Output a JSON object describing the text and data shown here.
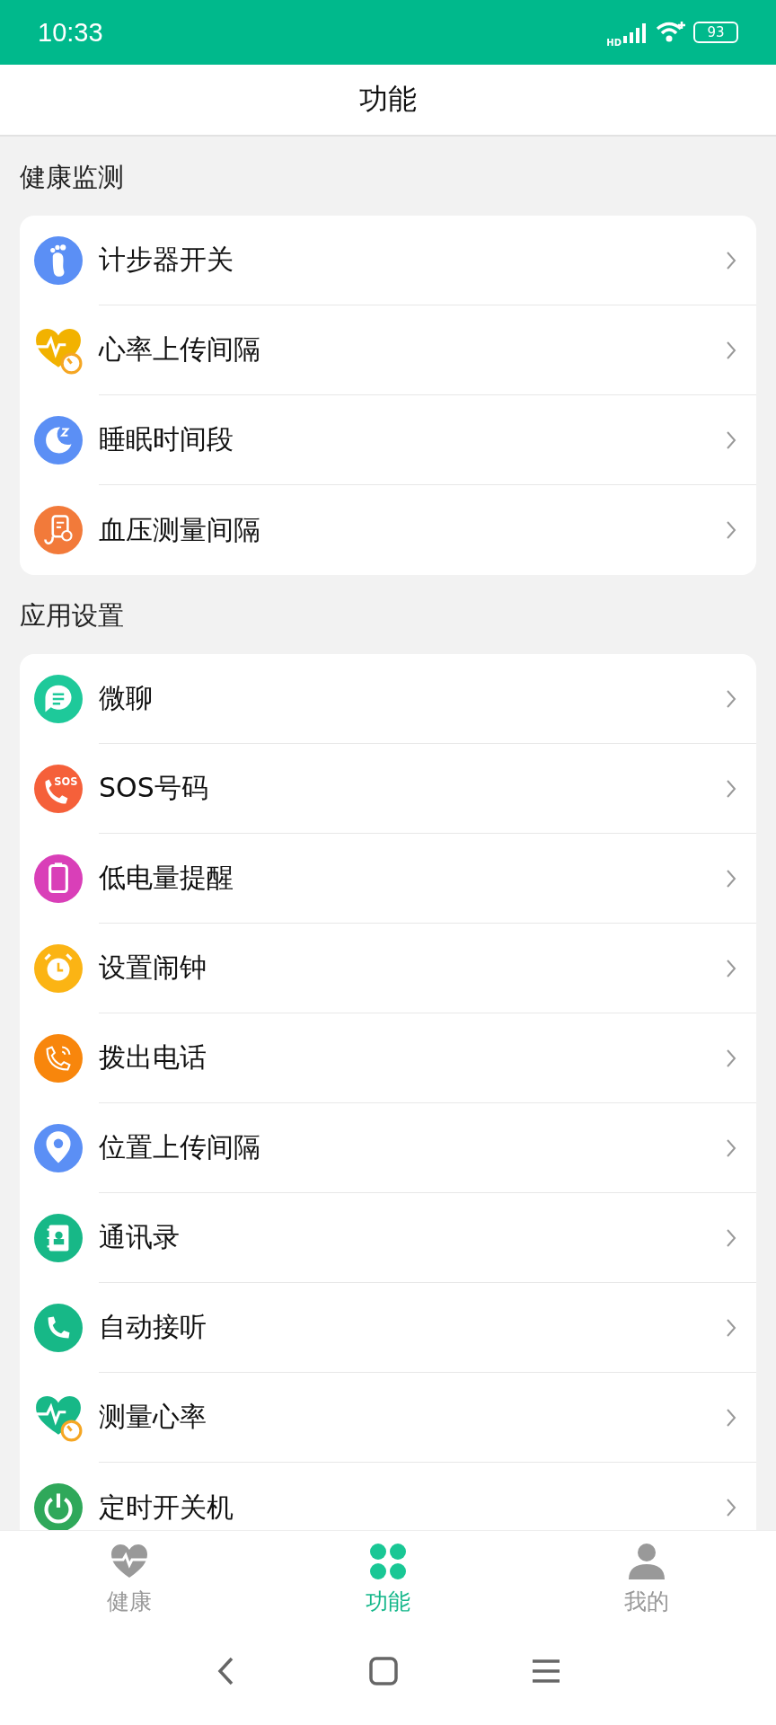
{
  "status_bar": {
    "time": "10:33",
    "battery": "93",
    "network": "HD"
  },
  "header": {
    "title": "功能"
  },
  "sections": [
    {
      "title": "健康监测",
      "items": [
        {
          "label": "计步器开关",
          "kind": "foot",
          "color": "#5b8ff5"
        },
        {
          "label": "心率上传间隔",
          "kind": "heart",
          "color": "#f2b200"
        },
        {
          "label": "睡眠时间段",
          "kind": "moon",
          "color": "#5b8ff5"
        },
        {
          "label": "血压测量间隔",
          "kind": "pressure",
          "color": "#f27a3a"
        }
      ]
    },
    {
      "title": "应用设置",
      "items": [
        {
          "label": "微聊",
          "kind": "chat",
          "color": "#1ec99a"
        },
        {
          "label": "SOS号码",
          "kind": "sos",
          "color": "#f5603a",
          "badge": "SOS"
        },
        {
          "label": "低电量提醒",
          "kind": "battery",
          "color": "#d93fb8"
        },
        {
          "label": "设置闹钟",
          "kind": "alarm",
          "color": "#fbb414"
        },
        {
          "label": "拨出电话",
          "kind": "call",
          "color": "#f8860c"
        },
        {
          "label": "位置上传间隔",
          "kind": "pin",
          "color": "#5b8ff5"
        },
        {
          "label": "通讯录",
          "kind": "contacts",
          "color": "#17b887"
        },
        {
          "label": "自动接听",
          "kind": "phone",
          "color": "#17b887"
        },
        {
          "label": "测量心率",
          "kind": "heart",
          "color": "#17b887"
        },
        {
          "label": "定时开关机",
          "kind": "power",
          "color": "#2fa85a"
        }
      ]
    }
  ],
  "tabs": [
    {
      "label": "健康",
      "kind": "heart",
      "selected": false
    },
    {
      "label": "功能",
      "kind": "clover",
      "selected": true
    },
    {
      "label": "我的",
      "kind": "person",
      "selected": false
    }
  ]
}
